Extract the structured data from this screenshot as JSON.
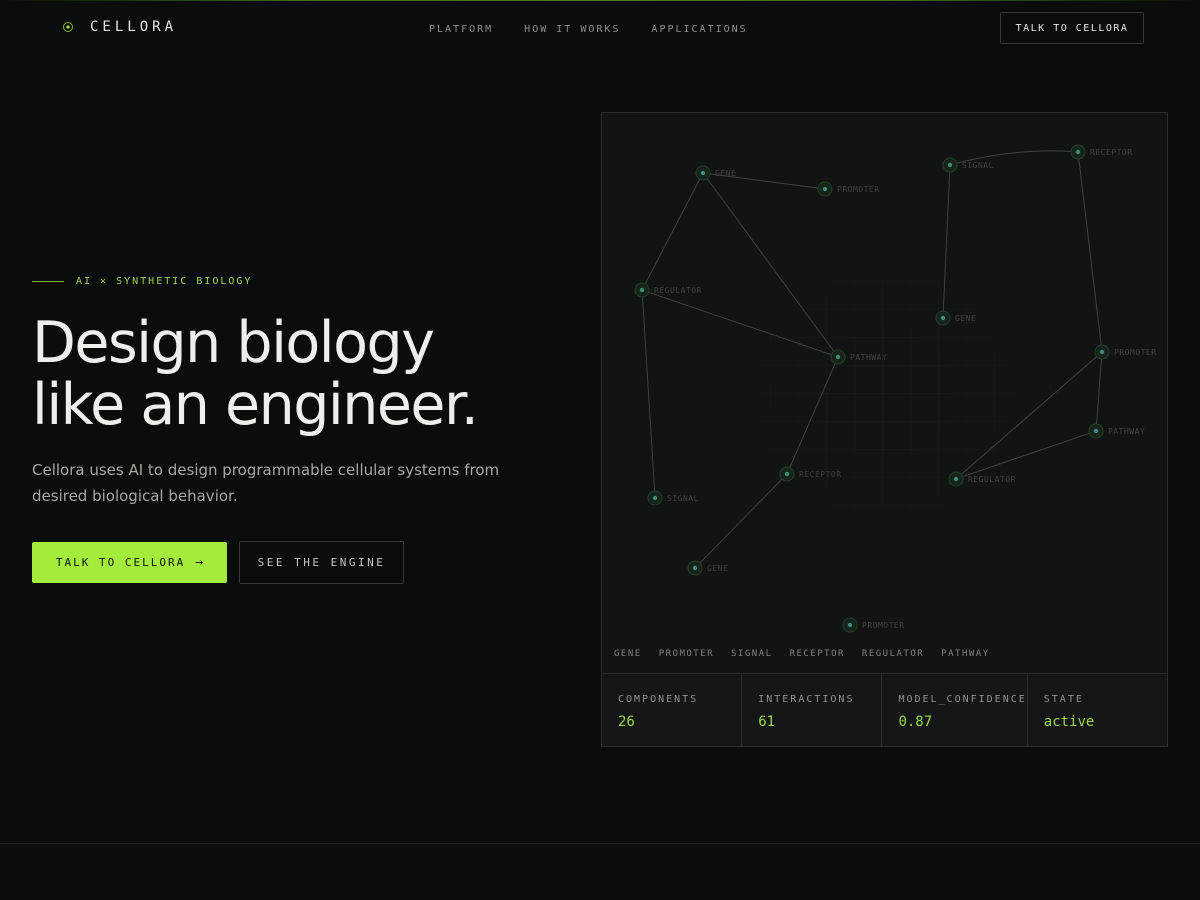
{
  "header": {
    "logo_text": "CELLORA",
    "logo_icon": "cell-target-icon",
    "nav": [
      "PLATFORM",
      "HOW IT WORKS",
      "APPLICATIONS"
    ],
    "cta_label": "TALK TO CELLORA"
  },
  "hero": {
    "eyebrow": "AI × SYNTHETIC BIOLOGY",
    "headline_line1": "Design biology",
    "headline_line2": "like an engineer.",
    "subtext": "Cellora uses AI to design programmable cellular systems from desired biological behavior.",
    "primary_button": "TALK TO CELLORA",
    "primary_arrow": "→",
    "secondary_button": "SEE THE ENGINE"
  },
  "engine": {
    "nodes": [
      {
        "id": "n1",
        "label": "GENE"
      },
      {
        "id": "n2",
        "label": "PROMOTER"
      },
      {
        "id": "n3",
        "label": "SIGNAL"
      },
      {
        "id": "n4",
        "label": "RECEPTOR"
      },
      {
        "id": "n5",
        "label": "REGULATOR"
      },
      {
        "id": "n6",
        "label": "GENE"
      },
      {
        "id": "n7",
        "label": "PATHWAY"
      },
      {
        "id": "n8",
        "label": "PROMOTER"
      },
      {
        "id": "n9",
        "label": "PATHWAY"
      },
      {
        "id": "n10",
        "label": "RECEPTOR"
      },
      {
        "id": "n11",
        "label": "REGULATOR"
      },
      {
        "id": "n12",
        "label": "SIGNAL"
      },
      {
        "id": "n13",
        "label": "GENE"
      },
      {
        "id": "n14",
        "label": "PROMOTER"
      }
    ],
    "edges": [
      [
        "n1",
        "n2"
      ],
      [
        "n1",
        "n5"
      ],
      [
        "n1",
        "n7"
      ],
      [
        "n5",
        "n7"
      ],
      [
        "n5",
        "n12"
      ],
      [
        "n7",
        "n10"
      ],
      [
        "n10",
        "n13"
      ],
      [
        "n3",
        "n4"
      ],
      [
        "n3",
        "n6"
      ],
      [
        "n4",
        "n8"
      ],
      [
        "n8",
        "n9"
      ],
      [
        "n8",
        "n11"
      ],
      [
        "n9",
        "n11"
      ]
    ],
    "legend": [
      "GENE",
      "PROMOTER",
      "SIGNAL",
      "RECEPTOR",
      "REGULATOR",
      "PATHWAY"
    ],
    "stats": [
      {
        "label": "COMPONENTS",
        "value": "26"
      },
      {
        "label": "INTERACTIONS",
        "value": "61"
      },
      {
        "label": "MODEL_CONFIDENCE",
        "value": "0.87"
      },
      {
        "label": "STATE",
        "value": "active"
      }
    ]
  },
  "colors": {
    "accent": "#a3ec3b",
    "background": "#0b0d0c",
    "panel": "#121413",
    "node": "#3b8c7c"
  }
}
